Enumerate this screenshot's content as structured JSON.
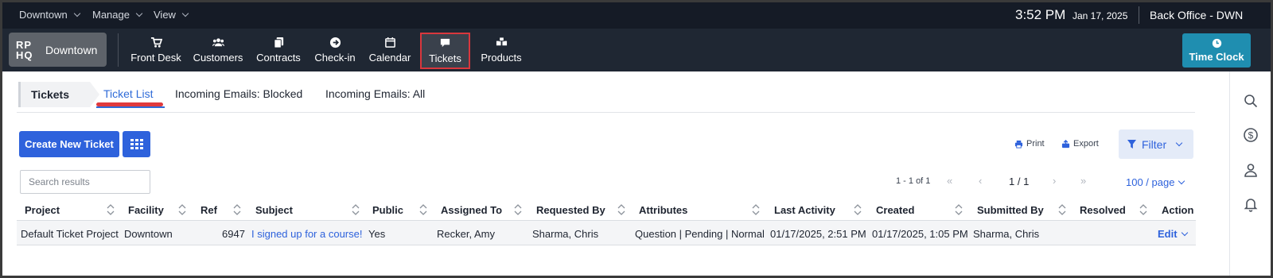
{
  "topbar": {
    "menus": [
      "Downtown",
      "Manage",
      "View"
    ],
    "time": "3:52 PM",
    "date": "Jan 17, 2025",
    "office": "Back Office - DWN"
  },
  "brand": {
    "logo": "RP HQ",
    "location": "Downtown"
  },
  "nav": {
    "items": [
      {
        "label": "Front Desk",
        "icon": "cart-icon"
      },
      {
        "label": "Customers",
        "icon": "users-icon"
      },
      {
        "label": "Contracts",
        "icon": "documents-icon"
      },
      {
        "label": "Check-in",
        "icon": "arrow-circle-icon"
      },
      {
        "label": "Calendar",
        "icon": "calendar-icon"
      },
      {
        "label": "Tickets",
        "icon": "chat-bubble-icon",
        "active": true
      },
      {
        "label": "Products",
        "icon": "boxes-icon"
      }
    ],
    "time_clock_label": "Time Clock"
  },
  "tabs": {
    "section": "Tickets",
    "items": [
      "Ticket List",
      "Incoming Emails: Blocked",
      "Incoming Emails: All"
    ],
    "active": "Ticket List"
  },
  "toolbar": {
    "create_label": "Create New Ticket",
    "print_label": "Print",
    "export_label": "Export",
    "filter_label": "Filter"
  },
  "search": {
    "placeholder": "Search results",
    "value": ""
  },
  "pager": {
    "count": "1 - 1 of 1",
    "first": "«",
    "prev": "‹",
    "page": "1 / 1",
    "next": "›",
    "last": "»",
    "per_page": "100 / page"
  },
  "table": {
    "columns": [
      "Project",
      "Facility",
      "Ref",
      "Subject",
      "Public",
      "Assigned To",
      "Requested By",
      "Attributes",
      "Last Activity",
      "Created",
      "Submitted By",
      "Resolved",
      "Action"
    ],
    "rows": [
      {
        "project": "Default Ticket Project",
        "facility": "Downtown",
        "ref": "6947",
        "subject": "I signed up for a course!",
        "public": "Yes",
        "assigned_to": "Recker, Amy",
        "requested_by": "Sharma, Chris",
        "attributes": "Question | Pending | Normal",
        "last_activity": "01/17/2025, 2:51 PM",
        "created": "01/17/2025, 1:05 PM",
        "submitted_by": "Sharma, Chris",
        "resolved": "",
        "action": "Edit"
      }
    ]
  },
  "colors": {
    "topbar_bg": "#151b26",
    "navbar_bg": "#1f2733",
    "primary": "#2e62dc",
    "time_clock": "#1f8eb0",
    "highlight": "#e03a3e"
  }
}
